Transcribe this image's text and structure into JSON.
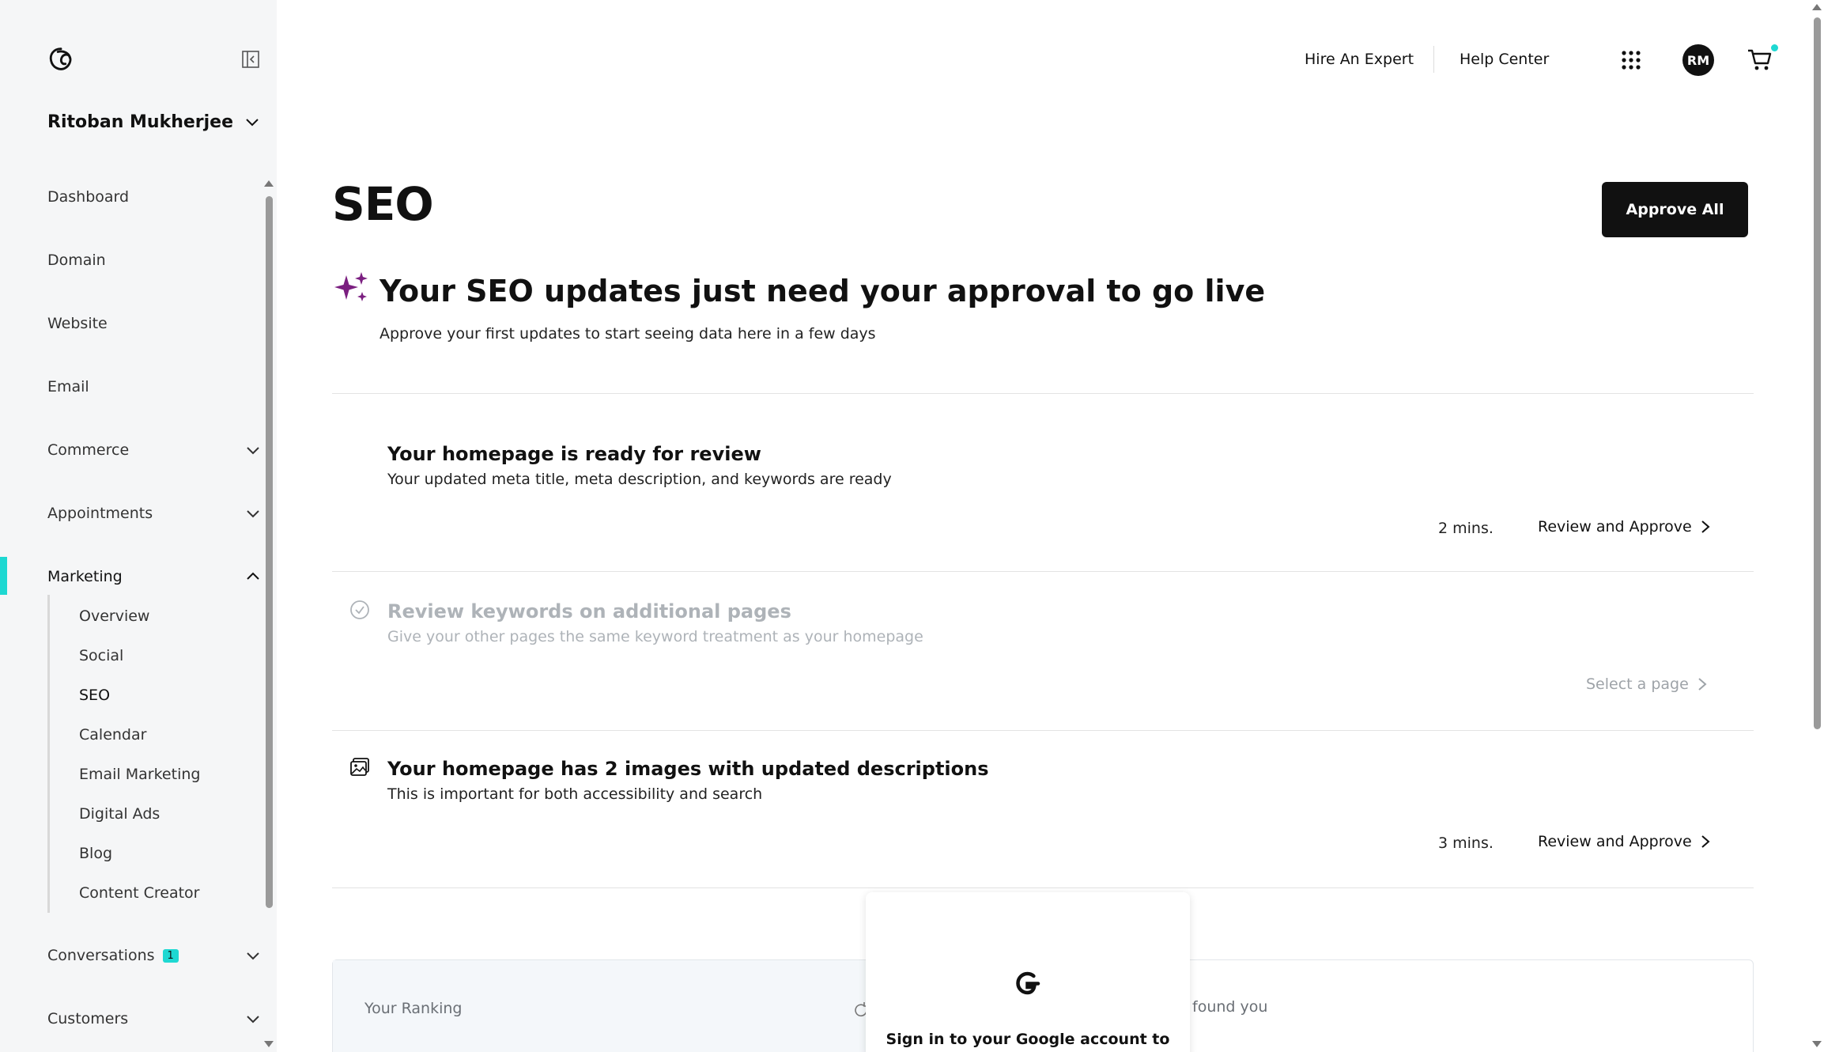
{
  "sidebar": {
    "account_name": "Ritoban Mukherjee",
    "items": [
      {
        "label": "Dashboard"
      },
      {
        "label": "Domain"
      },
      {
        "label": "Website"
      },
      {
        "label": "Email"
      },
      {
        "label": "Commerce"
      },
      {
        "label": "Appointments"
      },
      {
        "label": "Marketing"
      },
      {
        "label": "Conversations",
        "badge": "1"
      },
      {
        "label": "Customers"
      }
    ],
    "marketing_subitems": [
      {
        "label": "Overview"
      },
      {
        "label": "Social"
      },
      {
        "label": "SEO"
      },
      {
        "label": "Calendar"
      },
      {
        "label": "Email Marketing"
      },
      {
        "label": "Digital Ads"
      },
      {
        "label": "Blog"
      },
      {
        "label": "Content Creator"
      }
    ]
  },
  "topbar": {
    "hire_expert": "Hire An Expert",
    "help_center": "Help Center",
    "avatar_initials": "RM"
  },
  "main": {
    "title": "SEO",
    "approve_all": "Approve All",
    "headline": "Your SEO updates just need your approval to go live",
    "subheadline": "Approve your first updates to start seeing data here in a few days",
    "tasks": [
      {
        "title": "Your homepage is ready for review",
        "desc": "Your updated meta title, meta description, and keywords are ready",
        "time": "2 mins.",
        "action": "Review and Approve"
      },
      {
        "title": "Review keywords on additional pages",
        "desc": "Give your other pages the same keyword treatment as your homepage",
        "action": "Select a page"
      },
      {
        "title": "Your homepage has 2 images with updated descriptions",
        "desc": "This is important for both accessibility and search",
        "time": "3 mins.",
        "action": "Review and Approve"
      }
    ],
    "ranking_label": "Your Ranking",
    "found_text": "found you",
    "google_signin": "Sign in to your Google account to"
  },
  "colors": {
    "accent": "#1ed8d2",
    "sparkle": "#7b1f80",
    "button_bg": "#111111"
  }
}
